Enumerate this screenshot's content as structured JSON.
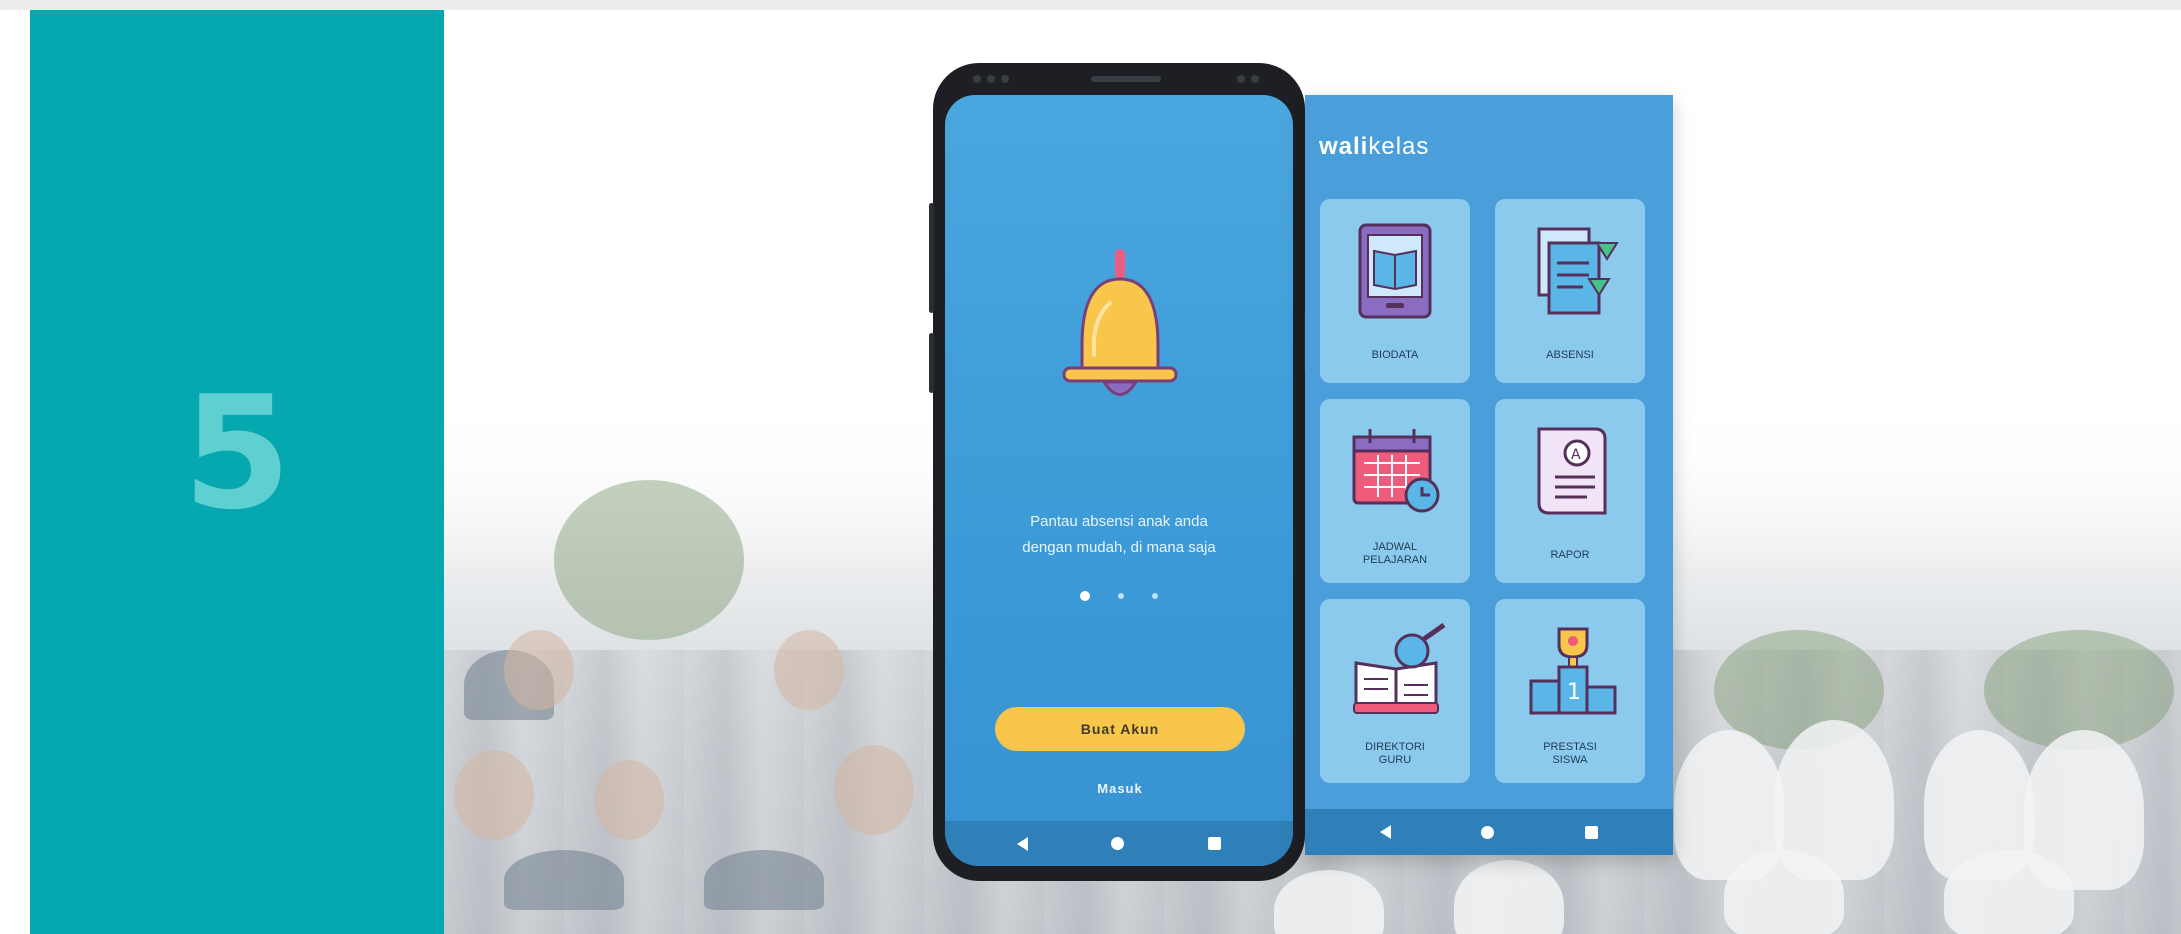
{
  "slide": {
    "step_number": "5"
  },
  "onboarding": {
    "tagline_line1": "Pantau absensi anak anda",
    "tagline_line2": "dengan mudah, di mana saja",
    "create_account_label": "Buat Akun",
    "login_label": "Masuk",
    "pager": {
      "total": 3,
      "active": 1
    }
  },
  "app": {
    "brand_bold": "wali",
    "brand_rest": "kelas",
    "menu": [
      {
        "label": "BIODATA",
        "icon": "tablet-book-icon"
      },
      {
        "label": "ABSENSI",
        "icon": "document-download-icon"
      },
      {
        "label_line1": "JADWAL",
        "label_line2": "PELAJARAN",
        "icon": "calendar-clock-icon"
      },
      {
        "label": "RAPOR",
        "icon": "report-grade-icon"
      },
      {
        "label_line1": "DIREKTORI",
        "label_line2": "GURU",
        "icon": "book-search-icon"
      },
      {
        "label_line1": "PRESTASI",
        "label_line2": "SISWA",
        "icon": "trophy-podium-icon"
      }
    ]
  },
  "colors": {
    "teal": "#04a8ae",
    "screen_blue": "#4a9fda",
    "button_yellow": "#f7c64a",
    "tile_blue": "#8ccaed"
  }
}
